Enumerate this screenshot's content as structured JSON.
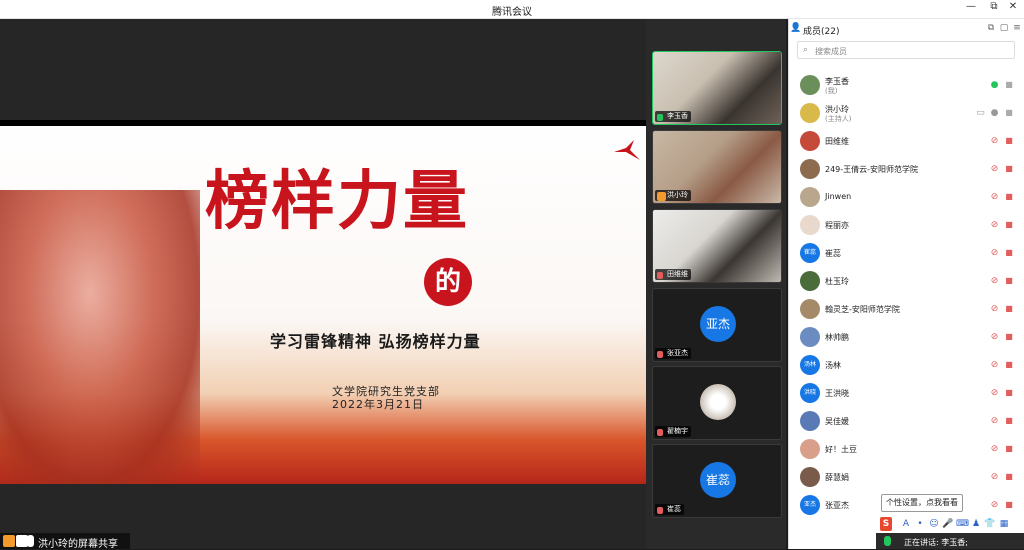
{
  "window": {
    "title": "腾讯会议"
  },
  "window_controls": {
    "minimize": "—",
    "restore": "⧉",
    "close": "✕"
  },
  "slide": {
    "title_art": "榜样力量",
    "title_de": "的",
    "subtitle": "学习雷锋精神  弘扬榜样力量",
    "org": "文学院研究生党支部",
    "date": "2022年3月21日"
  },
  "share_bar": {
    "label": "洪小玲的屏幕共享"
  },
  "video_tiles": [
    {
      "name": "李玉香",
      "camera": true,
      "active": true,
      "mic": "on"
    },
    {
      "name": "洪小玲",
      "camera": true,
      "active": false,
      "mic": "host"
    },
    {
      "name": "田维维",
      "camera": true,
      "active": false,
      "mic": "muted"
    },
    {
      "name": "张亚杰",
      "camera": false,
      "avatar_text": "亚杰",
      "mic": "muted"
    },
    {
      "name": "翟楠宇",
      "camera": false,
      "avatar_photo": true,
      "mic": "muted"
    },
    {
      "name": "崔蕊",
      "camera": false,
      "avatar_text": "崔蕊",
      "mic": "muted"
    }
  ],
  "sidebar": {
    "title": "成员(22)",
    "search_placeholder": "搜索成员",
    "members": [
      {
        "name": "李玉香",
        "role": "(我)",
        "avatar_color": "#6a8f5a",
        "mic": "on"
      },
      {
        "name": "洪小玲",
        "role": "(主持人)",
        "avatar_color": "#d9b94a",
        "mic": "sharing"
      },
      {
        "name": "田维维",
        "avatar_color": "#c64a3a",
        "mic": "muted"
      },
      {
        "name": "249-王倩云-安阳师范学院",
        "avatar_color": "#8c6b4f",
        "mic": "muted"
      },
      {
        "name": "Jinwen",
        "avatar_color": "#b9a78d",
        "mic": "muted"
      },
      {
        "name": "程丽亦",
        "avatar_color": "#e9d9cc",
        "mic": "muted"
      },
      {
        "name": "崔蕊",
        "avatar_color": "#1677e5",
        "avatar_text": "崔蕊",
        "mic": "muted"
      },
      {
        "name": "杜玉玲",
        "avatar_color": "#4a6b3a",
        "mic": "muted"
      },
      {
        "name": "翰灵芝-安阳师范学院",
        "avatar_color": "#a58a6a",
        "mic": "muted"
      },
      {
        "name": "林帅鹏",
        "avatar_color": "#6b8cc0",
        "mic": "muted"
      },
      {
        "name": "汤林",
        "avatar_color": "#1677e5",
        "avatar_text": "汤林",
        "mic": "muted"
      },
      {
        "name": "王洪晓",
        "avatar_color": "#1677e5",
        "avatar_text": "洪晓",
        "mic": "muted"
      },
      {
        "name": "吴佳媛",
        "avatar_color": "#5a7ab5",
        "mic": "muted"
      },
      {
        "name": "好！土豆",
        "avatar_color": "#d8a08a",
        "mic": "muted"
      },
      {
        "name": "薛慧娟",
        "avatar_color": "#7a5a4a",
        "mic": "muted"
      },
      {
        "name": "张亚杰",
        "avatar_color": "#1677e5",
        "avatar_text": "亚杰",
        "mic": "muted"
      }
    ]
  },
  "tooltip": {
    "text": "个性设置，点我看看"
  },
  "ime_toolbar": {
    "logo": "S",
    "items": [
      "A",
      "•",
      "☺",
      "🎤",
      "⌨",
      "♟",
      "👕",
      "▦"
    ]
  },
  "speaking": {
    "label": "正在讲话: 李玉香;"
  },
  "colors": {
    "accent_green": "#23c55e",
    "avatar_blue": "#1677e5",
    "muted_red": "#e35d5d",
    "slide_red": "#c8141c"
  }
}
